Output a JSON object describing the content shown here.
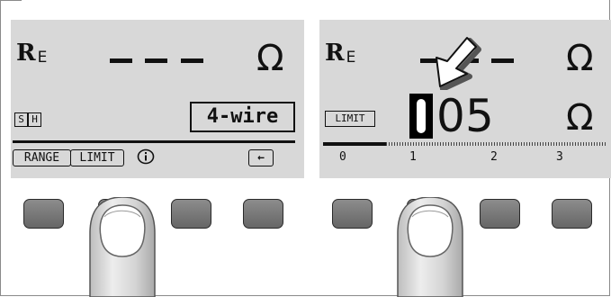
{
  "left_panel": {
    "quantity_symbol": "R",
    "quantity_subscript": "E",
    "unit_symbol": "Ω",
    "status_flags": [
      "S",
      "H"
    ],
    "mode_label": "4-wire",
    "softkeys": {
      "range": "RANGE",
      "limit": "LIMIT",
      "info": "i",
      "back": "←"
    }
  },
  "right_panel": {
    "quantity_symbol": "R",
    "quantity_subscript": "E",
    "unit_symbol": "Ω",
    "limit_badge": "LIMIT",
    "limit_digits": [
      "0",
      "0",
      "5"
    ],
    "unit_symbol_value": "Ω",
    "scale_labels": [
      "0",
      "1",
      "2",
      "3"
    ]
  },
  "colors": {
    "lcd_background": "#d8d8d8",
    "key_gray": "#7a7a7a",
    "ink": "#111111"
  },
  "icons": [
    "info-icon",
    "back-arrow-icon",
    "pointer-arrow-icon",
    "finger-icon"
  ]
}
